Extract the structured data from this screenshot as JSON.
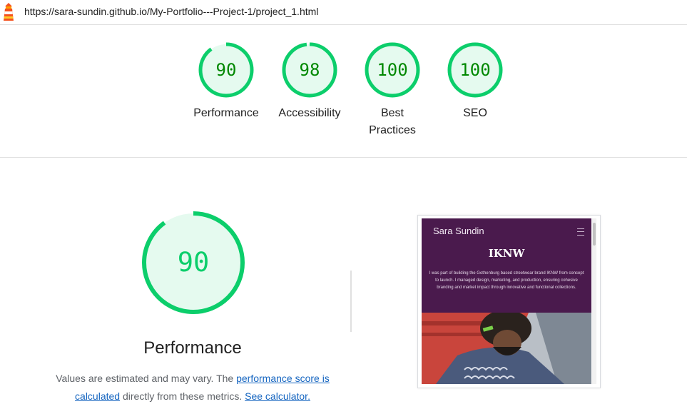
{
  "header": {
    "url": "https://sara-sundin.github.io/My-Portfolio---Project-1/project_1.html",
    "logo_icon": "lighthouse-icon"
  },
  "gauges": [
    {
      "score": 90,
      "label": "Performance"
    },
    {
      "score": 98,
      "label": "Accessibility"
    },
    {
      "score": 100,
      "label": "Best Practices"
    },
    {
      "score": 100,
      "label": "SEO"
    }
  ],
  "performance": {
    "score": 90,
    "title": "Performance",
    "description_before": "Values are estimated and may vary. The ",
    "score_link": "performance score is calculated",
    "description_middle": " directly from these metrics. ",
    "calculator_link": "See calculator."
  },
  "screenshot": {
    "brand": "Sara Sundin",
    "menu_icon": "hamburger-menu-icon",
    "hero_title": "IKNW",
    "hero_text": "I was part of building the Gothenburg based streetwear brand IKNW from concept to launch. I managed design, marketing, and production, ensuring cohesive branding and market impact through innovative and functional collections."
  },
  "colors": {
    "pass_green": "#0cce6b",
    "pass_text": "#008800",
    "pass_fill": "#e5faef",
    "link_blue": "#1565c0",
    "hero_purple": "#4a1a4d"
  }
}
